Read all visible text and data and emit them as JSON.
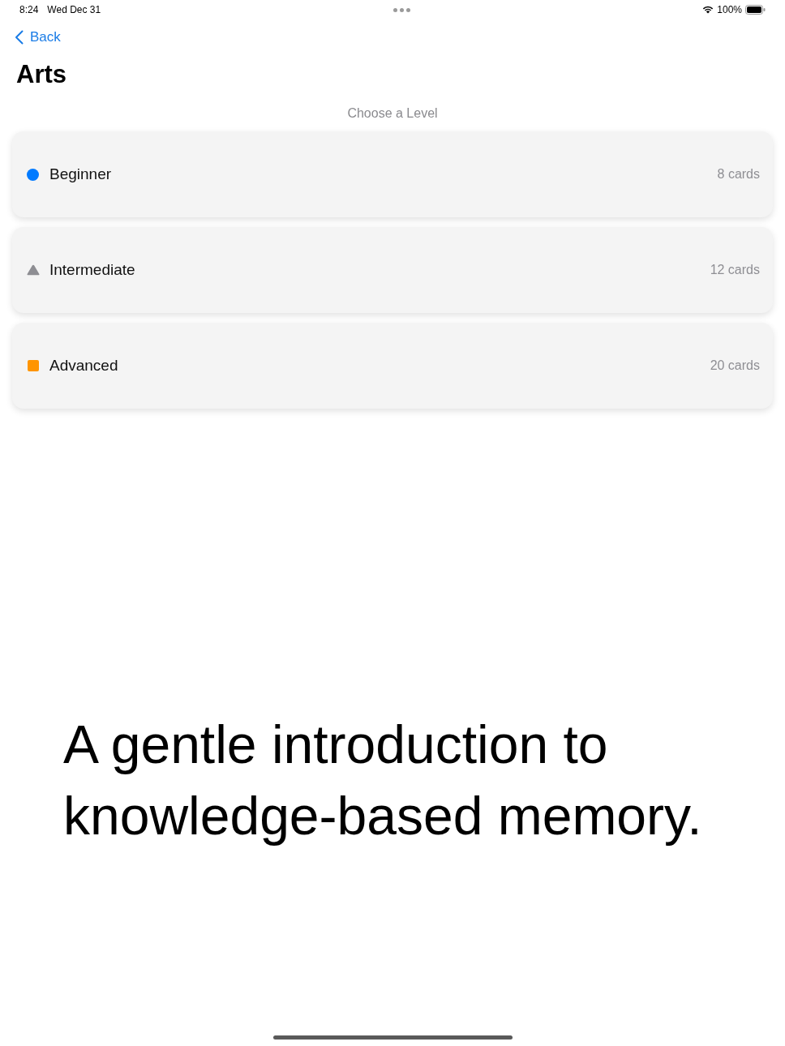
{
  "status_bar": {
    "time": "8:24",
    "date": "Wed Dec 31",
    "battery": "100%"
  },
  "nav": {
    "back": "Back",
    "title": "Arts"
  },
  "section_label": "Choose a Level",
  "levels": [
    {
      "kind": "circle",
      "color": "#007aff",
      "name": "Beginner",
      "count": "8 cards"
    },
    {
      "kind": "triangle",
      "color": "#8e8e93",
      "name": "Intermediate",
      "count": "12 cards"
    },
    {
      "kind": "square",
      "color": "#ff9500",
      "name": "Advanced",
      "count": "20 cards"
    }
  ],
  "caption": "A gentle introduction to knowledge-based memory."
}
